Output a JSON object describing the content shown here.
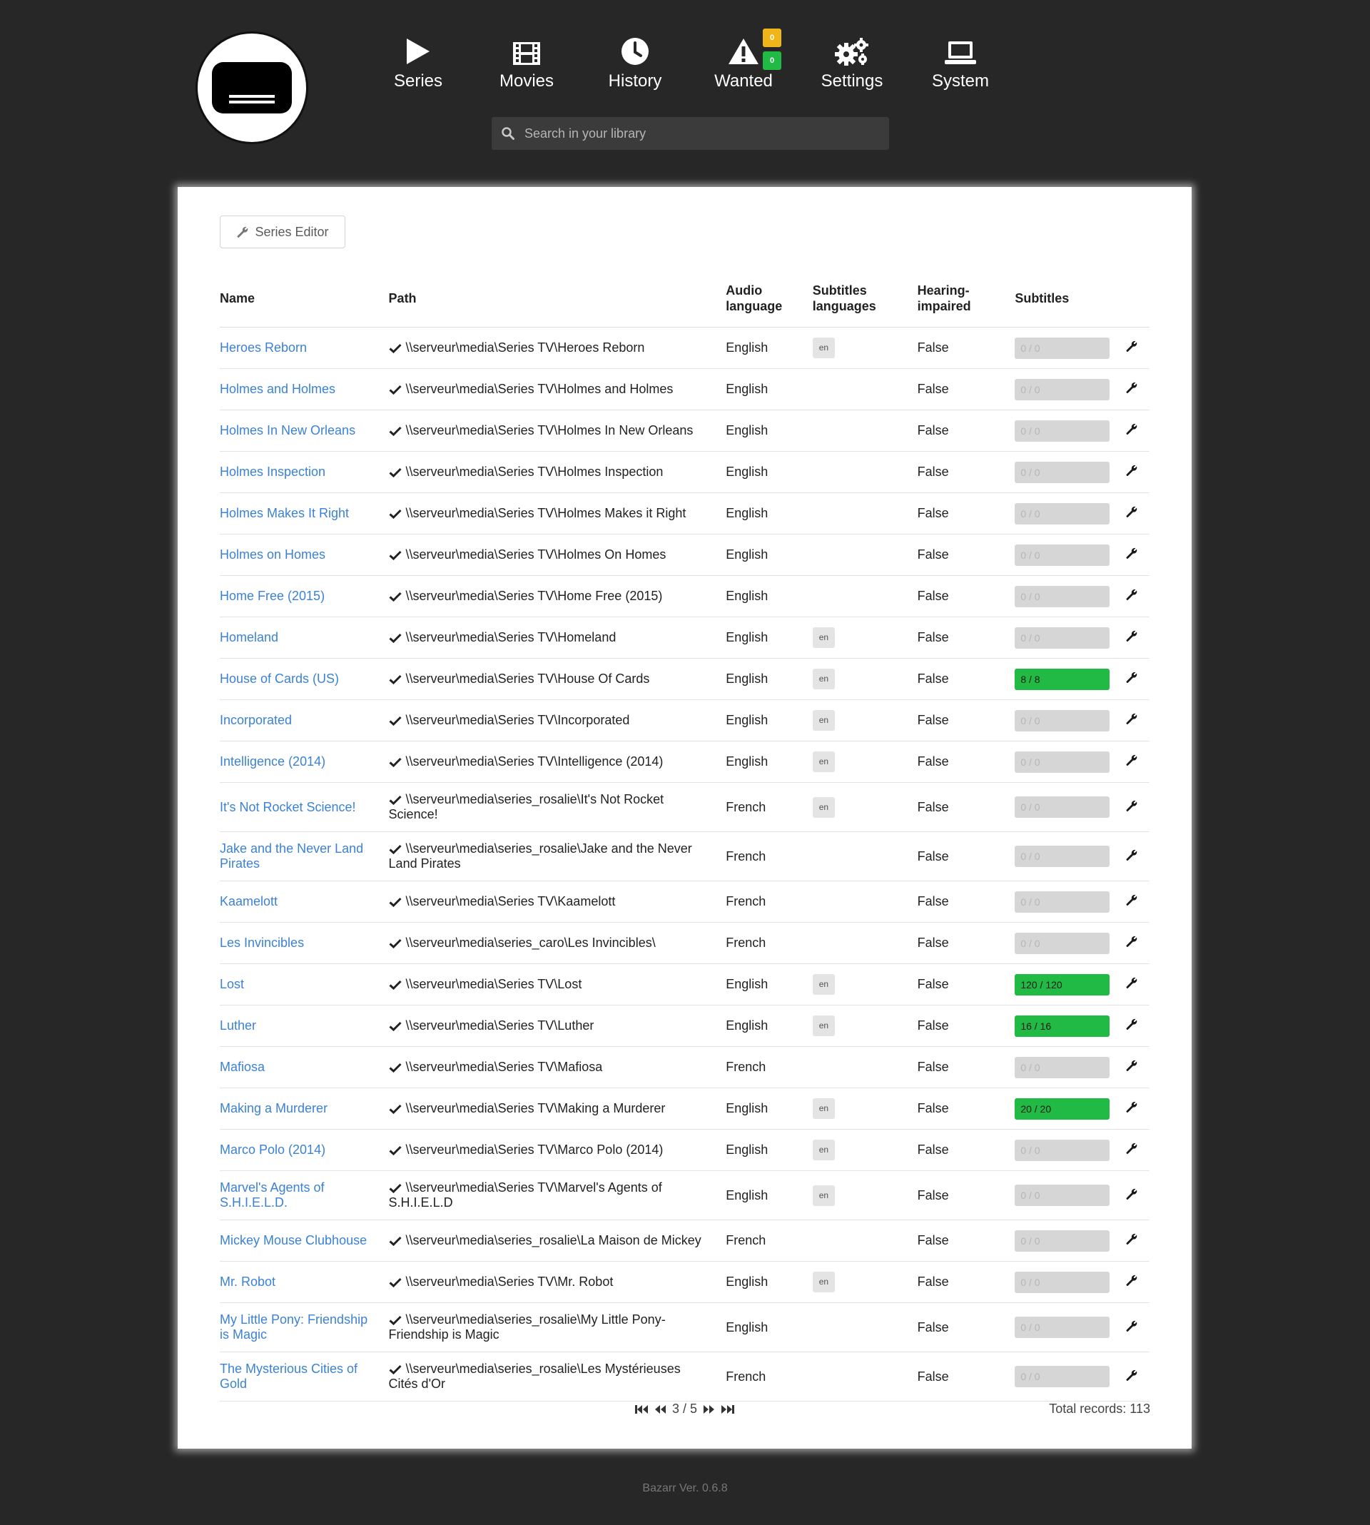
{
  "nav": {
    "items": [
      {
        "label": "Series",
        "icon": "play-icon"
      },
      {
        "label": "Movies",
        "icon": "film-icon"
      },
      {
        "label": "History",
        "icon": "clock-icon"
      },
      {
        "label": "Wanted",
        "icon": "warning-icon"
      },
      {
        "label": "Settings",
        "icon": "gears-icon"
      },
      {
        "label": "System",
        "icon": "laptop-icon"
      }
    ],
    "wanted_badges": {
      "series_count": "0",
      "movies_count": "0"
    }
  },
  "search": {
    "placeholder": "Search in your library"
  },
  "toolbar": {
    "series_editor_label": "Series Editor"
  },
  "table": {
    "headers": {
      "name": "Name",
      "path": "Path",
      "audio_line1": "Audio",
      "audio_line2": "language",
      "subl_line1": "Subtitles",
      "subl_line2": "languages",
      "hi_line1": "Hearing-",
      "hi_line2": "impaired",
      "subtitles": "Subtitles"
    },
    "rows": [
      {
        "name": "Heroes Reborn",
        "path": "\\\\serveur\\media\\Series TV\\Heroes Reborn",
        "audio": "English",
        "sub_lang": "en",
        "hi": "False",
        "subs": "0 / 0",
        "progress": 0
      },
      {
        "name": "Holmes and Holmes",
        "path": "\\\\serveur\\media\\Series TV\\Holmes and Holmes",
        "audio": "English",
        "sub_lang": "",
        "hi": "False",
        "subs": "0 / 0",
        "progress": 0
      },
      {
        "name": "Holmes In New Orleans",
        "path": "\\\\serveur\\media\\Series TV\\Holmes In New Orleans",
        "audio": "English",
        "sub_lang": "",
        "hi": "False",
        "subs": "0 / 0",
        "progress": 0
      },
      {
        "name": "Holmes Inspection",
        "path": "\\\\serveur\\media\\Series TV\\Holmes Inspection",
        "audio": "English",
        "sub_lang": "",
        "hi": "False",
        "subs": "0 / 0",
        "progress": 0
      },
      {
        "name": "Holmes Makes It Right",
        "path": "\\\\serveur\\media\\Series TV\\Holmes Makes it Right",
        "audio": "English",
        "sub_lang": "",
        "hi": "False",
        "subs": "0 / 0",
        "progress": 0
      },
      {
        "name": "Holmes on Homes",
        "path": "\\\\serveur\\media\\Series TV\\Holmes On Homes",
        "audio": "English",
        "sub_lang": "",
        "hi": "False",
        "subs": "0 / 0",
        "progress": 0
      },
      {
        "name": "Home Free (2015)",
        "path": "\\\\serveur\\media\\Series TV\\Home Free (2015)",
        "audio": "English",
        "sub_lang": "",
        "hi": "False",
        "subs": "0 / 0",
        "progress": 0
      },
      {
        "name": "Homeland",
        "path": "\\\\serveur\\media\\Series TV\\Homeland",
        "audio": "English",
        "sub_lang": "en",
        "hi": "False",
        "subs": "0 / 0",
        "progress": 0
      },
      {
        "name": "House of Cards (US)",
        "path": "\\\\serveur\\media\\Series TV\\House Of Cards",
        "audio": "English",
        "sub_lang": "en",
        "hi": "False",
        "subs": "8 / 8",
        "progress": 1
      },
      {
        "name": "Incorporated",
        "path": "\\\\serveur\\media\\Series TV\\Incorporated",
        "audio": "English",
        "sub_lang": "en",
        "hi": "False",
        "subs": "0 / 0",
        "progress": 0
      },
      {
        "name": "Intelligence (2014)",
        "path": "\\\\serveur\\media\\Series TV\\Intelligence (2014)",
        "audio": "English",
        "sub_lang": "en",
        "hi": "False",
        "subs": "0 / 0",
        "progress": 0
      },
      {
        "name": "It's Not Rocket Science!",
        "path": "\\\\serveur\\media\\series_rosalie\\It's Not Rocket Science!",
        "audio": "French",
        "sub_lang": "en",
        "hi": "False",
        "subs": "0 / 0",
        "progress": 0,
        "tall": true
      },
      {
        "name": "Jake and the Never Land Pirates",
        "path": "\\\\serveur\\media\\series_rosalie\\Jake and the Never Land Pirates",
        "audio": "French",
        "sub_lang": "",
        "hi": "False",
        "subs": "0 / 0",
        "progress": 0,
        "tall": true
      },
      {
        "name": "Kaamelott",
        "path": "\\\\serveur\\media\\Series TV\\Kaamelott",
        "audio": "French",
        "sub_lang": "",
        "hi": "False",
        "subs": "0 / 0",
        "progress": 0
      },
      {
        "name": "Les Invincibles",
        "path": "\\\\serveur\\media\\series_caro\\Les Invincibles\\",
        "audio": "French",
        "sub_lang": "",
        "hi": "False",
        "subs": "0 / 0",
        "progress": 0
      },
      {
        "name": "Lost",
        "path": "\\\\serveur\\media\\Series TV\\Lost",
        "audio": "English",
        "sub_lang": "en",
        "hi": "False",
        "subs": "120 / 120",
        "progress": 1
      },
      {
        "name": "Luther",
        "path": "\\\\serveur\\media\\Series TV\\Luther",
        "audio": "English",
        "sub_lang": "en",
        "hi": "False",
        "subs": "16 / 16",
        "progress": 1
      },
      {
        "name": "Mafiosa",
        "path": "\\\\serveur\\media\\Series TV\\Mafiosa",
        "audio": "French",
        "sub_lang": "",
        "hi": "False",
        "subs": "0 / 0",
        "progress": 0
      },
      {
        "name": "Making a Murderer",
        "path": "\\\\serveur\\media\\Series TV\\Making a Murderer",
        "audio": "English",
        "sub_lang": "en",
        "hi": "False",
        "subs": "20 / 20",
        "progress": 1
      },
      {
        "name": "Marco Polo (2014)",
        "path": "\\\\serveur\\media\\Series TV\\Marco Polo (2014)",
        "audio": "English",
        "sub_lang": "en",
        "hi": "False",
        "subs": "0 / 0",
        "progress": 0
      },
      {
        "name": "Marvel's Agents of S.H.I.E.L.D.",
        "path": "\\\\serveur\\media\\Series TV\\Marvel's Agents of S.H.I.E.L.D",
        "audio": "English",
        "sub_lang": "en",
        "hi": "False",
        "subs": "0 / 0",
        "progress": 0,
        "tall": true
      },
      {
        "name": "Mickey Mouse Clubhouse",
        "path": "\\\\serveur\\media\\series_rosalie\\La Maison de Mickey",
        "audio": "French",
        "sub_lang": "",
        "hi": "False",
        "subs": "0 / 0",
        "progress": 0
      },
      {
        "name": "Mr. Robot",
        "path": "\\\\serveur\\media\\Series TV\\Mr. Robot",
        "audio": "English",
        "sub_lang": "en",
        "hi": "False",
        "subs": "0 / 0",
        "progress": 0
      },
      {
        "name": "My Little Pony: Friendship is Magic",
        "path": "\\\\serveur\\media\\series_rosalie\\My Little Pony- Friendship is Magic",
        "audio": "English",
        "sub_lang": "",
        "hi": "False",
        "subs": "0 / 0",
        "progress": 0,
        "tall": true
      },
      {
        "name": "The Mysterious Cities of Gold",
        "path": "\\\\serveur\\media\\series_rosalie\\Les Mystérieuses Cités d'Or",
        "audio": "French",
        "sub_lang": "",
        "hi": "False",
        "subs": "0 / 0",
        "progress": 0,
        "tall": true
      }
    ]
  },
  "pagination": {
    "page_info": "3 / 5",
    "total_label": "Total records: 113"
  },
  "footer": {
    "version": "Bazarr Ver. 0.6.8"
  },
  "colors": {
    "accent_link": "#3b82d6",
    "progress_full": "#21ba45",
    "badge_warning": "#f0b619",
    "badge_success": "#21ba45",
    "background": "#272727"
  }
}
